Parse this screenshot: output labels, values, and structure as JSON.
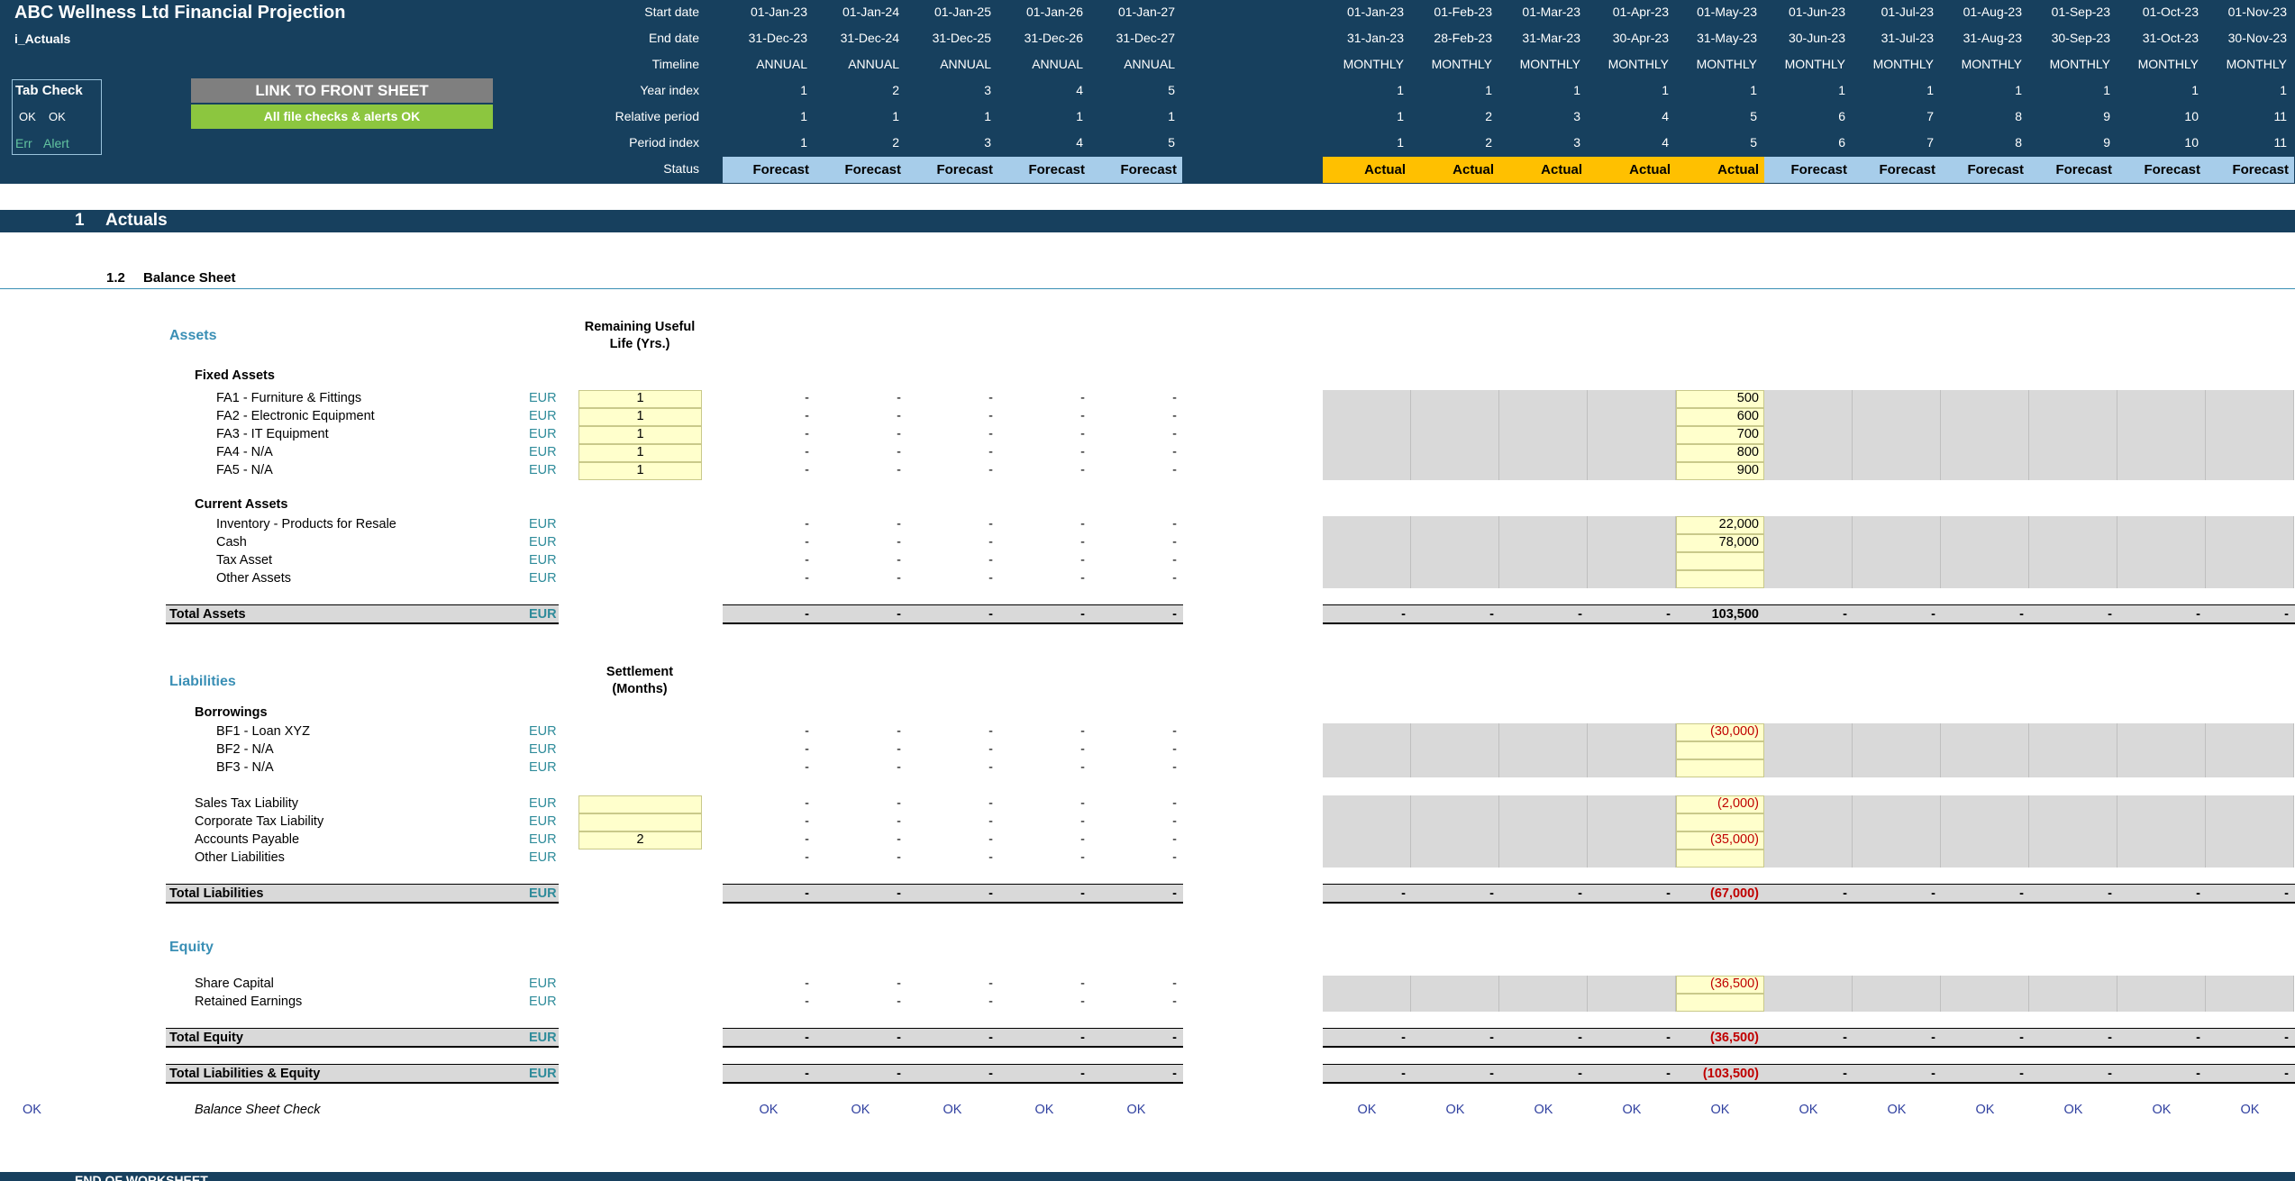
{
  "app": {
    "title": "ABC Wellness Ltd Financial Projection",
    "sheet_name": "i_Actuals"
  },
  "tab_check": {
    "title": "Tab Check",
    "ok1": "OK",
    "ok2": "OK",
    "err": "Err",
    "alert": "Alert"
  },
  "buttons": {
    "link_front": "LINK TO FRONT SHEET",
    "checks_ok": "All file checks & alerts OK"
  },
  "header_labels": [
    "Start date",
    "End date",
    "Timeline",
    "Year index",
    "Relative period",
    "Period index",
    "Status"
  ],
  "annual": {
    "start": [
      "01-Jan-23",
      "01-Jan-24",
      "01-Jan-25",
      "01-Jan-26",
      "01-Jan-27"
    ],
    "end": [
      "31-Dec-23",
      "31-Dec-24",
      "31-Dec-25",
      "31-Dec-26",
      "31-Dec-27"
    ],
    "timeline": [
      "ANNUAL",
      "ANNUAL",
      "ANNUAL",
      "ANNUAL",
      "ANNUAL"
    ],
    "year_index": [
      "1",
      "2",
      "3",
      "4",
      "5"
    ],
    "relative": [
      "1",
      "1",
      "1",
      "1",
      "1"
    ],
    "period_index": [
      "1",
      "2",
      "3",
      "4",
      "5"
    ],
    "status": [
      "Forecast",
      "Forecast",
      "Forecast",
      "Forecast",
      "Forecast"
    ]
  },
  "monthly": {
    "start": [
      "01-Jan-23",
      "01-Feb-23",
      "01-Mar-23",
      "01-Apr-23",
      "01-May-23",
      "01-Jun-23",
      "01-Jul-23",
      "01-Aug-23",
      "01-Sep-23",
      "01-Oct-23",
      "01-Nov-23"
    ],
    "end": [
      "31-Jan-23",
      "28-Feb-23",
      "31-Mar-23",
      "30-Apr-23",
      "31-May-23",
      "30-Jun-23",
      "31-Jul-23",
      "31-Aug-23",
      "30-Sep-23",
      "31-Oct-23",
      "30-Nov-23"
    ],
    "timeline": [
      "MONTHLY",
      "MONTHLY",
      "MONTHLY",
      "MONTHLY",
      "MONTHLY",
      "MONTHLY",
      "MONTHLY",
      "MONTHLY",
      "MONTHLY",
      "MONTHLY",
      "MONTHLY"
    ],
    "year_index": [
      "1",
      "1",
      "1",
      "1",
      "1",
      "1",
      "1",
      "1",
      "1",
      "1",
      "1"
    ],
    "relative": [
      "1",
      "2",
      "3",
      "4",
      "5",
      "6",
      "7",
      "8",
      "9",
      "10",
      "11"
    ],
    "period_index": [
      "1",
      "2",
      "3",
      "4",
      "5",
      "6",
      "7",
      "8",
      "9",
      "10",
      "11"
    ],
    "status": [
      "Actual",
      "Actual",
      "Actual",
      "Actual",
      "Actual",
      "Forecast",
      "Forecast",
      "Forecast",
      "Forecast",
      "Forecast",
      "Forecast"
    ]
  },
  "section": {
    "number": "1",
    "title": "Actuals",
    "sub_number": "1.2",
    "sub_title": "Balance Sheet",
    "end": "END OF WORKSHEET"
  },
  "col_headers": {
    "useful_life_1": "Remaining Useful",
    "useful_life_2": "Life (Yrs.)",
    "settlement_1": "Settlement",
    "settlement_2": "(Months)"
  },
  "assets": {
    "title": "Assets",
    "fixed_title": "Fixed Assets",
    "fixed": [
      {
        "label": "FA1 - Furniture & Fittings",
        "unit": "EUR",
        "input": "1",
        "may": "500"
      },
      {
        "label": "FA2 - Electronic Equipment",
        "unit": "EUR",
        "input": "1",
        "may": "600"
      },
      {
        "label": "FA3 - IT Equipment",
        "unit": "EUR",
        "input": "1",
        "may": "700"
      },
      {
        "label": "FA4 - N/A",
        "unit": "EUR",
        "input": "1",
        "may": "800"
      },
      {
        "label": "FA5 - N/A",
        "unit": "EUR",
        "input": "1",
        "may": "900"
      }
    ],
    "current_title": "Current Assets",
    "current": [
      {
        "label": "Inventory - Products for Resale",
        "unit": "EUR",
        "may": "22,000"
      },
      {
        "label": "Cash",
        "unit": "EUR",
        "may": "78,000"
      },
      {
        "label": "Tax Asset",
        "unit": "EUR",
        "may": ""
      },
      {
        "label": "Other Assets",
        "unit": "EUR",
        "may": ""
      }
    ],
    "total_label": "Total Assets",
    "total_unit": "EUR",
    "total_may": "103,500"
  },
  "liabilities": {
    "title": "Liabilities",
    "borrow_title": "Borrowings",
    "borrow": [
      {
        "label": "BF1 - Loan XYZ",
        "unit": "EUR",
        "may": "(30,000)"
      },
      {
        "label": "BF2 - N/A",
        "unit": "EUR",
        "may": ""
      },
      {
        "label": "BF3 - N/A",
        "unit": "EUR",
        "may": ""
      }
    ],
    "other": [
      {
        "label": "Sales Tax Liability",
        "unit": "EUR",
        "input": "",
        "has_input": true,
        "may": "(2,000)"
      },
      {
        "label": "Corporate Tax Liability",
        "unit": "EUR",
        "input": "",
        "has_input": true,
        "may": ""
      },
      {
        "label": "Accounts Payable",
        "unit": "EUR",
        "input": "2",
        "has_input": true,
        "may": "(35,000)"
      },
      {
        "label": "Other Liabilities",
        "unit": "EUR",
        "input": "",
        "has_input": false,
        "may": ""
      }
    ],
    "total_label": "Total Liabilities",
    "total_unit": "EUR",
    "total_may": "(67,000)"
  },
  "equity": {
    "title": "Equity",
    "rows": [
      {
        "label": "Share Capital",
        "unit": "EUR",
        "may": "(36,500)"
      },
      {
        "label": "Retained Earnings",
        "unit": "EUR",
        "may": ""
      }
    ],
    "total_label": "Total Equity",
    "total_unit": "EUR",
    "total_may": "(36,500)",
    "tle_label": "Total Liabilities & Equity",
    "tle_unit": "EUR",
    "tle_may": "(103,500)"
  },
  "check": {
    "left_ok": "OK",
    "label": "Balance Sheet Check",
    "value": "OK"
  },
  "dash": "-",
  "colors": {
    "header_bg": "#17405e",
    "forecast": "#a7cdea",
    "actual": "#ffc000",
    "input_cell": "#ffffcc",
    "grey_cell": "#d9d9d9",
    "button_grey": "#7f7f7f",
    "button_green": "#8cc63f"
  }
}
